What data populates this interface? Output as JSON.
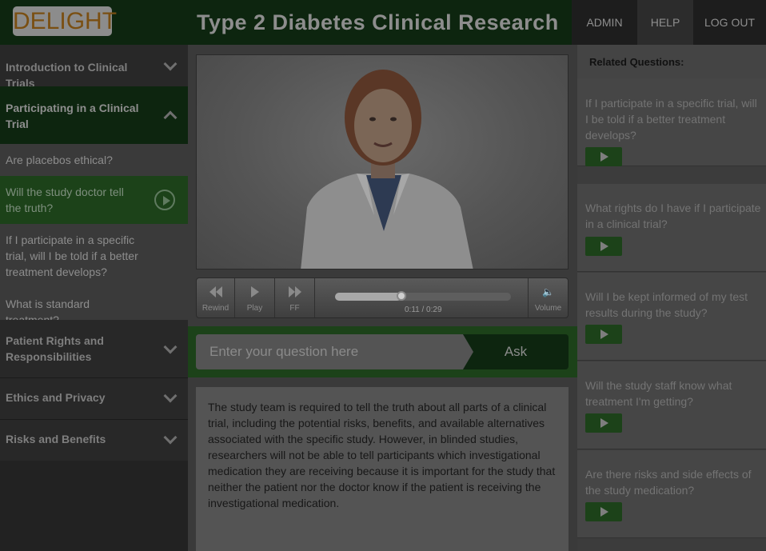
{
  "header": {
    "logo": "DELIGHT",
    "title": "Type 2 Diabetes Clinical Research",
    "nav": {
      "admin": "ADMIN",
      "help": "HELP",
      "logout": "LOG OUT"
    }
  },
  "sidebar": {
    "sections": [
      {
        "label": "Introduction to Clinical Trials",
        "state": "collapsed"
      },
      {
        "label": "Participating in a Clinical Trial",
        "state": "expanded"
      },
      {
        "label": "Patient Rights and Responsibilities",
        "state": "collapsed"
      },
      {
        "label": "Ethics and Privacy",
        "state": "collapsed"
      },
      {
        "label": "Risks and Benefits",
        "state": "collapsed"
      }
    ],
    "subitems": [
      {
        "label": "Are placebos ethical?"
      },
      {
        "label": "Will the study doctor tell the truth?",
        "current": true
      },
      {
        "label": "If I participate in a specific trial, will I be told if a better treatment develops?"
      },
      {
        "label": "What is standard treatment?"
      }
    ]
  },
  "player": {
    "rewind_label": "Rewind",
    "play_label": "Play",
    "ff_label": "FF",
    "volume_label": "Volume",
    "time": "0:11 / 0:29",
    "progress_fraction": 0.379
  },
  "ask": {
    "placeholder": "Enter your question here",
    "button": "Ask"
  },
  "answer": {
    "text": "The study team is required to tell the truth about all parts of a clinical trial, including the potential risks, benefits, and available alternatives associated with the specific study. However, in blinded studies, researchers will not be able to tell participants which investigational medication they are receiving because it is important for the study that neither the patient nor the doctor know if the patient is receiving the investigational medication."
  },
  "related": {
    "heading": "Related Questions:",
    "items": [
      {
        "question": "If I participate in a specific trial, will I be told if a better treatment develops?"
      },
      {
        "question": "What rights do I have if I participate in a clinical trial?"
      },
      {
        "question": "Will I be kept informed of my test results during the study?"
      },
      {
        "question": "Will the study staff know what treatment I'm getting?"
      },
      {
        "question": "Are there risks and side effects of the study medication?"
      }
    ]
  },
  "colors": {
    "brand_green_dark": "#0d250f",
    "brand_green": "#1c4219",
    "logo_text": "#7a4f12"
  }
}
